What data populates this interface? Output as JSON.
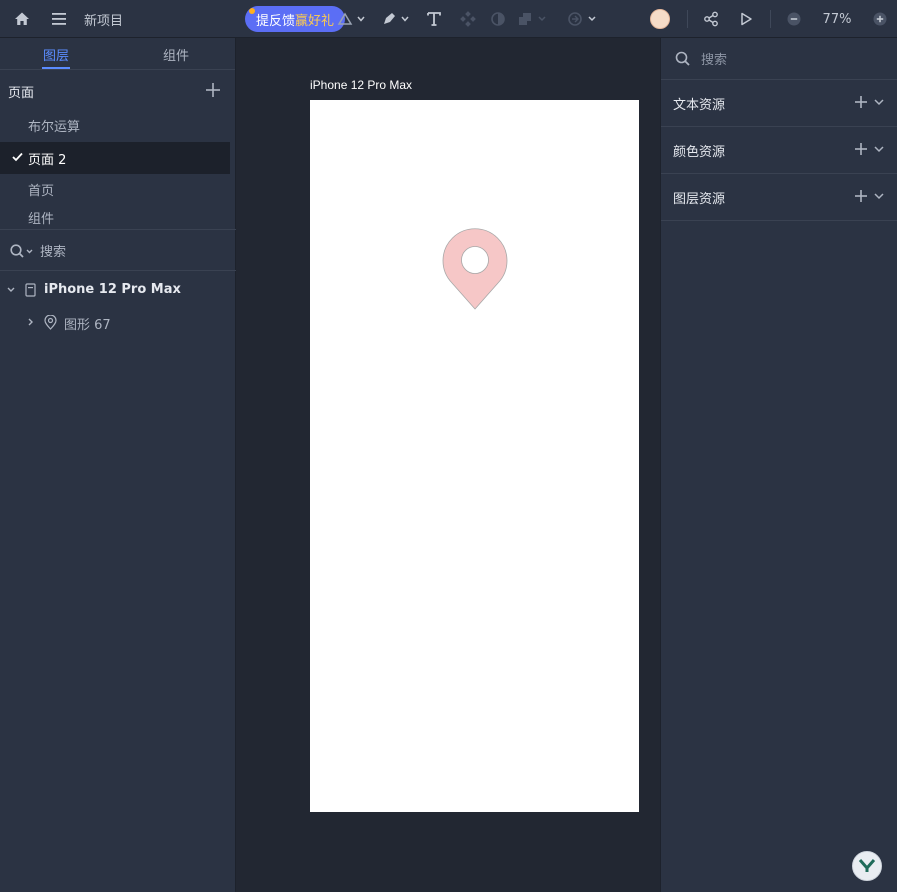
{
  "topbar": {
    "project_name": "新项目",
    "feedback": {
      "label_a": "提反馈",
      "label_b": "赢好礼"
    },
    "zoom_text": "77%",
    "icons": [
      "home-icon",
      "menu-icon",
      "shape-tool-icon",
      "pen-tool-icon",
      "text-tool-icon",
      "component-icon",
      "mask-icon",
      "boolean-icon",
      "prototype-icon",
      "share-icon",
      "play-icon",
      "zoom-out-icon",
      "zoom-in-icon"
    ]
  },
  "left_panel": {
    "tabs": [
      "图层",
      "组件"
    ],
    "pages_title": "页面",
    "pages": [
      {
        "label": "布尔运算",
        "active": false
      },
      {
        "label": "页面 2",
        "active": true
      },
      {
        "label": "首页",
        "active": false
      },
      {
        "label": "组件",
        "active": false
      }
    ],
    "layer_search": "搜索",
    "layers": {
      "root": "iPhone 12 Pro Max",
      "child": "图形 67"
    }
  },
  "canvas": {
    "frame_label": "iPhone 12 Pro Max",
    "pin_color": "#f6c7c7"
  },
  "right_panel": {
    "search": "搜索",
    "assets": [
      "文本资源",
      "颜色资源",
      "图层资源"
    ]
  },
  "colors": {
    "accent": "#5b8cff",
    "feedback_bg": "#5b6ef5",
    "panel_bg": "#2b3343",
    "canvas_bg": "#222732"
  }
}
